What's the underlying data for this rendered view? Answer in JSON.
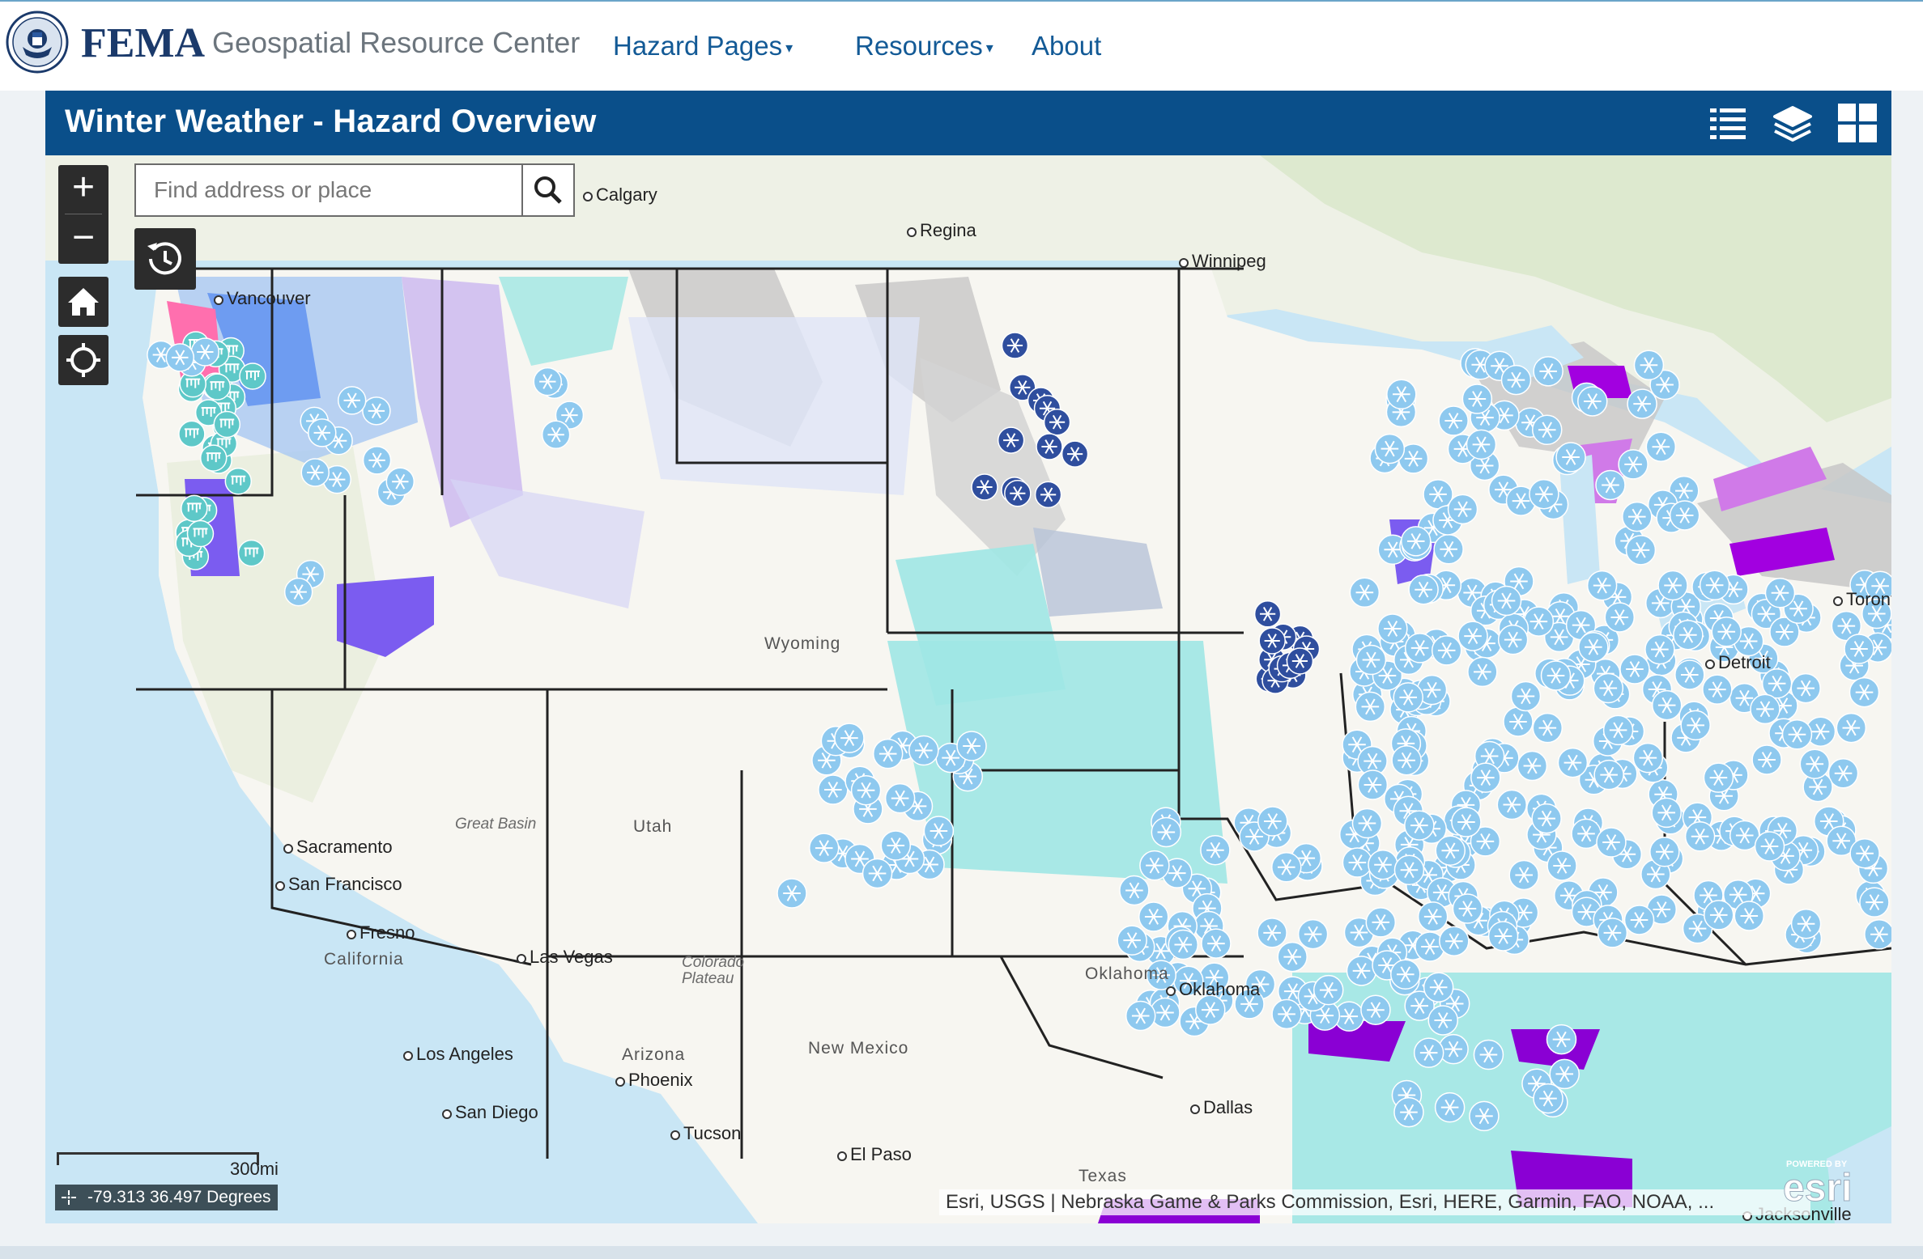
{
  "nav": {
    "brand": "FEMA",
    "subbrand": "Geospatial Resource Center",
    "links": [
      {
        "label": "Hazard Pages",
        "dropdown": true
      },
      {
        "label": "Resources",
        "dropdown": true
      },
      {
        "label": "About",
        "dropdown": false
      }
    ]
  },
  "header": {
    "title": "Winter Weather - Hazard Overview",
    "icons": [
      "legend-list-icon",
      "layers-icon",
      "basemap-grid-icon"
    ]
  },
  "search": {
    "placeholder": "Find address or place"
  },
  "map": {
    "cities": [
      "Calgary",
      "Regina",
      "Winnipeg",
      "Vancouver",
      "Sacramento",
      "San Francisco",
      "Fresno",
      "Las Vegas",
      "Los Angeles",
      "San Diego",
      "Phoenix",
      "Tucson",
      "El Paso",
      "Oklahoma",
      "Dallas",
      "Jacksonville",
      "Detroit",
      "Toronto"
    ],
    "states": [
      "Wyoming",
      "California",
      "Arizona",
      "New Mexico",
      "Texas",
      "Oklahoma",
      "Utah"
    ],
    "regions": [
      "Great Basin",
      "Colorado Plateau"
    ],
    "scale_label": "300mi",
    "coordinates": "-79.313 36.497 Degrees",
    "attribution": "Esri, USGS | Nebraska Game & Parks Commission, Esri, HERE, Garmin, FAO, NOAA, ...",
    "esri_logo": "esri",
    "colors": {
      "water": "#c9e6f5",
      "land": "#f7f6f1",
      "snow_light_blue": "#8ec9ef",
      "ice_cyan": "#5ec8c8",
      "advisory_teal": "#9fe7e4",
      "warning_purple": "#8a00d4",
      "watch_violet": "#c28ae8",
      "pink": "#ff6fae",
      "gray_zone": "#c7c7c7",
      "header_blue": "#0a4f8a",
      "dark_snow_marker": "#2f4e9e"
    }
  }
}
